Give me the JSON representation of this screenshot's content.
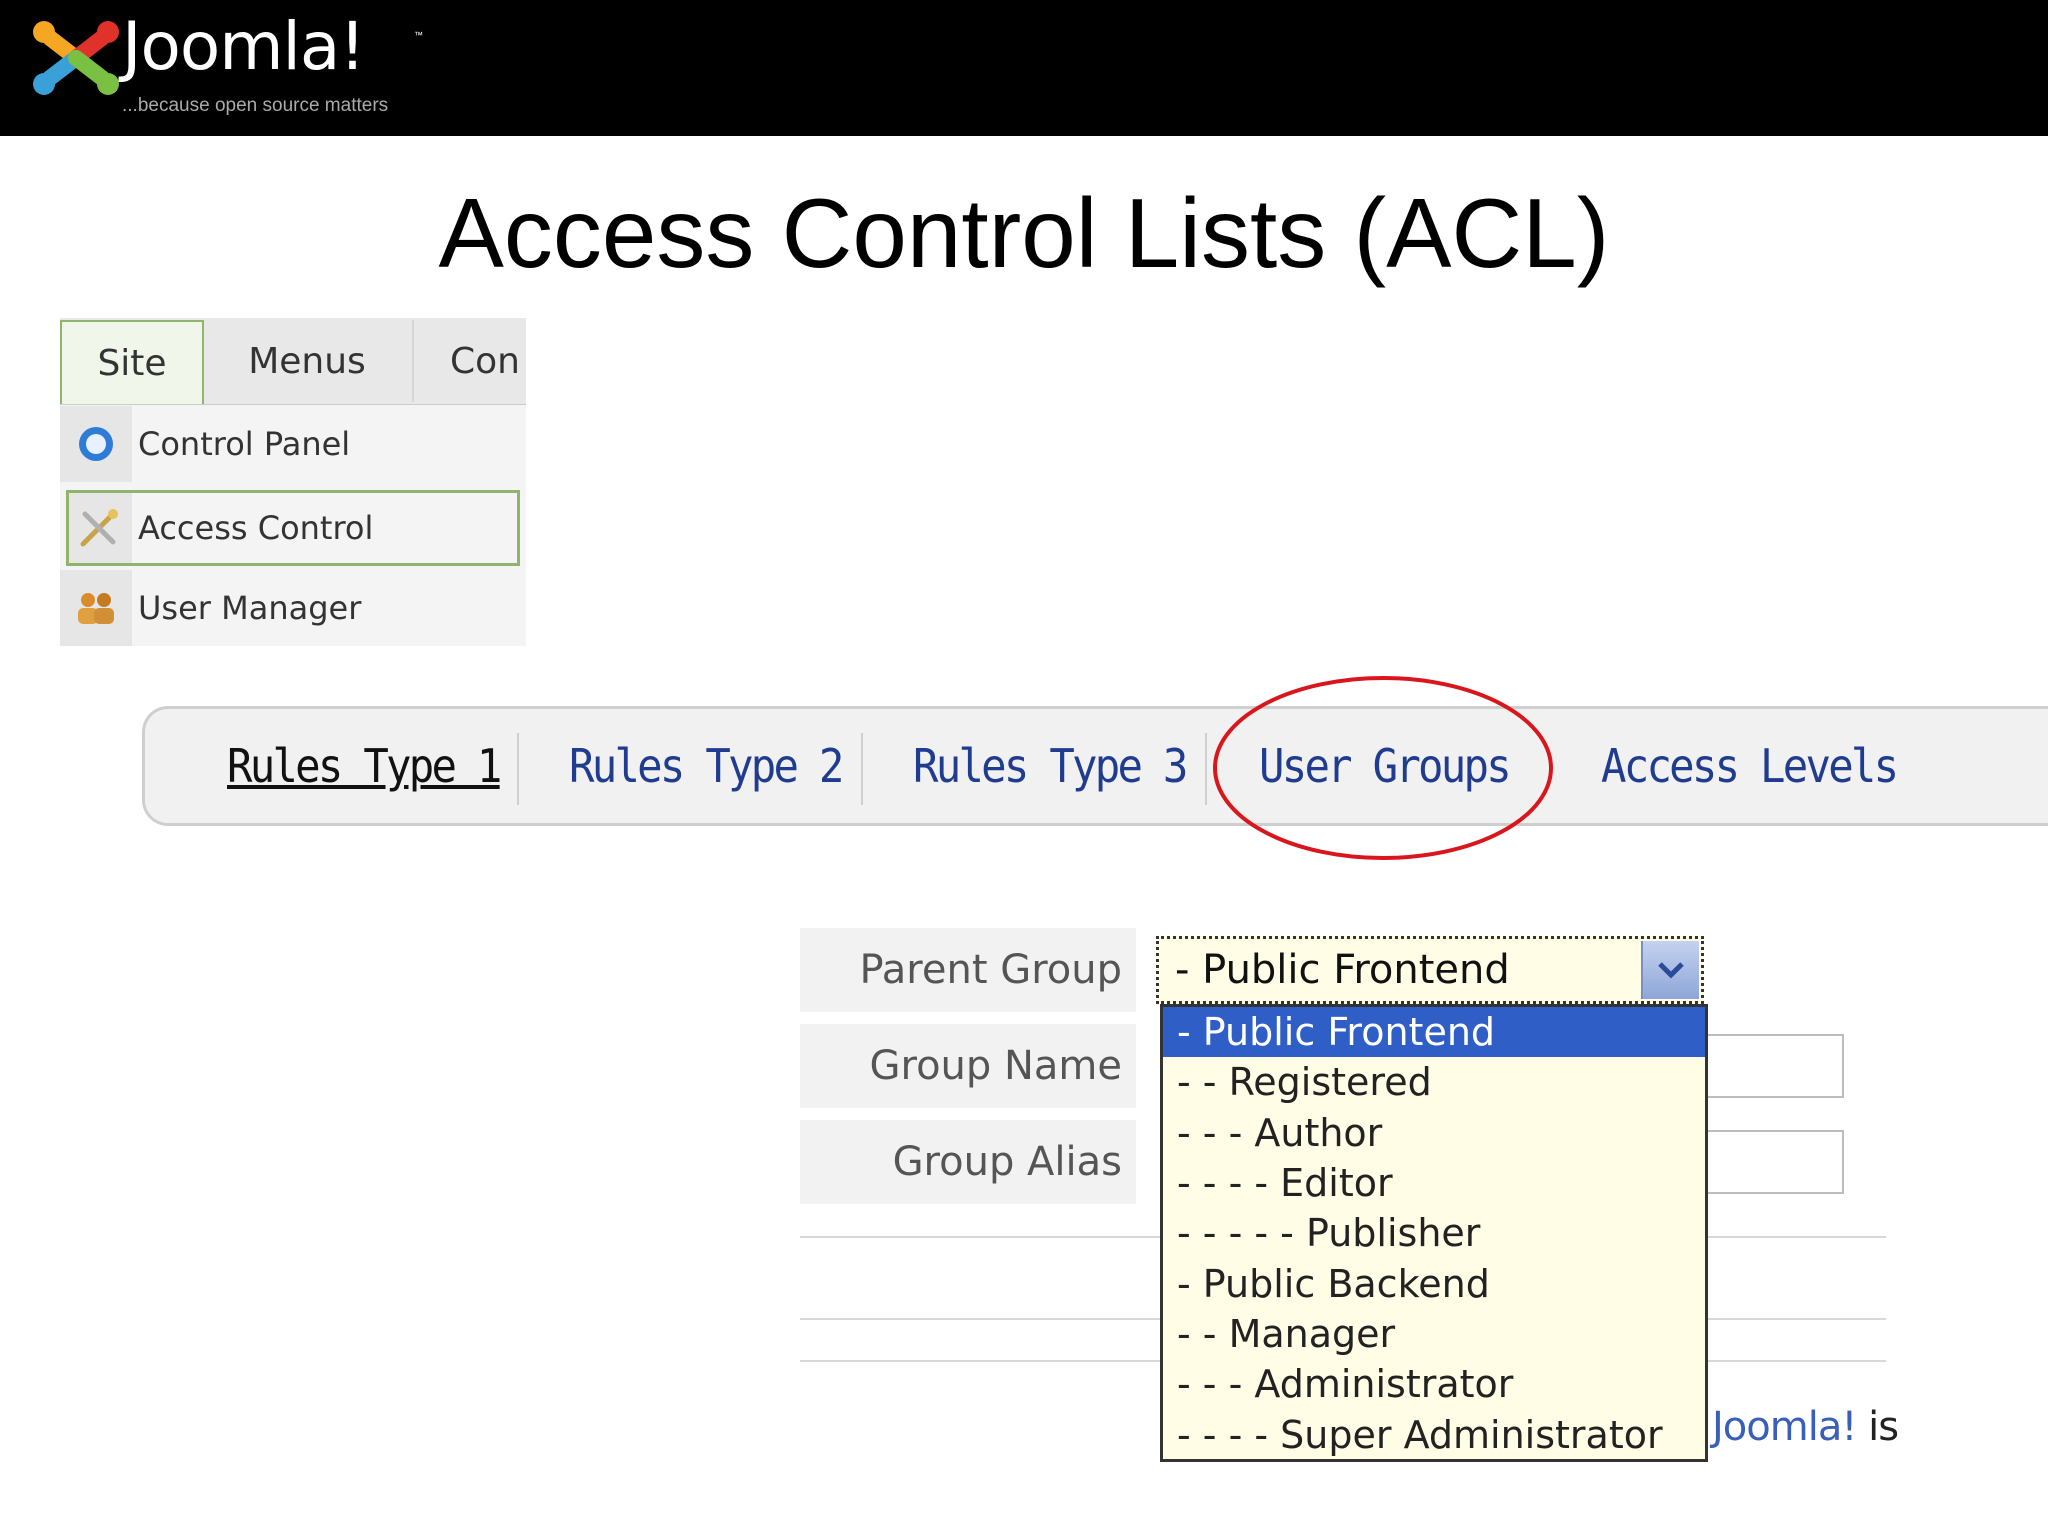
{
  "header": {
    "logo_text": "Joomla!",
    "logo_tm": "™",
    "tagline": "...because open source matters"
  },
  "slide": {
    "title": "Access Control Lists (ACL)"
  },
  "admin_menu": {
    "tabs": [
      "Site",
      "Menus",
      "Con"
    ],
    "items": [
      {
        "label": "Control Panel",
        "icon": "control-panel-icon"
      },
      {
        "label": "Access Control",
        "icon": "access-control-icon"
      },
      {
        "label": "User Manager",
        "icon": "user-manager-icon"
      }
    ]
  },
  "rules_tabs": {
    "tabs": [
      "Rules Type 1",
      "Rules Type 2",
      "Rules Type 3",
      "User Groups",
      "Access Levels"
    ],
    "current": "Rules Type 1",
    "highlighted": "User Groups"
  },
  "form": {
    "labels": {
      "parent_group": "Parent Group",
      "group_name": "Group Name",
      "group_alias": "Group Alias"
    },
    "parent_group_value": "- Public Frontend",
    "options": [
      "- Public Frontend",
      "- - Registered",
      "- - - Author",
      "- - - - Editor",
      "- - - - - Publisher",
      "- Public Backend",
      "- - Manager",
      "- - - Administrator",
      "- - - - Super Administrator"
    ],
    "footer_link": "Joomla!",
    "footer_tail": " is"
  },
  "colors": {
    "accent_red": "#d9161c",
    "link_blue": "#1f3c8f",
    "selection_blue": "#2f5ec7",
    "menu_green": "#8fb46b"
  }
}
